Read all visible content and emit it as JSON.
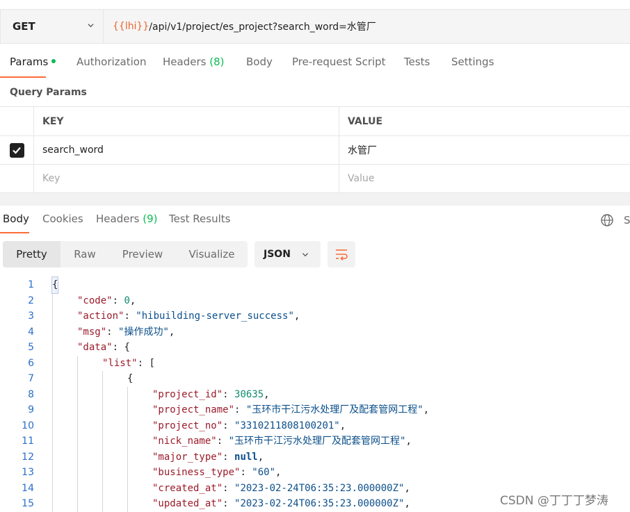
{
  "request": {
    "method": "GET",
    "url_var": "{{lhi}}",
    "url_rest": "/api/v1/project/es_project?search_word=水管厂"
  },
  "request_tabs": {
    "params": "Params",
    "authorization": "Authorization",
    "headers": "Headers",
    "headers_count": "(8)",
    "body": "Body",
    "prerequest": "Pre-request Script",
    "tests": "Tests",
    "settings": "Settings"
  },
  "query_params": {
    "title": "Query Params",
    "col_key": "KEY",
    "col_value": "VALUE",
    "row_key": "search_word",
    "row_value": "水管厂",
    "row_checked": true,
    "placeholder_key": "Key",
    "placeholder_value": "Value"
  },
  "response_tabs": {
    "body": "Body",
    "cookies": "Cookies",
    "headers": "Headers",
    "headers_count": "(9)",
    "test_results": "Test Results",
    "save_truncated": "S"
  },
  "format": {
    "pretty": "Pretty",
    "raw": "Raw",
    "preview": "Preview",
    "visualize": "Visualize",
    "language": "JSON"
  },
  "code": {
    "line_numbers": [
      "1",
      "2",
      "3",
      "4",
      "5",
      "6",
      "7",
      "8",
      "9",
      "10",
      "11",
      "12",
      "13",
      "14",
      "15"
    ],
    "l1": "{",
    "l2_key": "\"code\"",
    "l2_val": "0",
    "l3_key": "\"action\"",
    "l3_val": "\"hibuilding-server_success\"",
    "l4_key": "\"msg\"",
    "l4_val": "\"操作成功\"",
    "l5_key": "\"data\"",
    "l5_open": "{",
    "l6_key": "\"list\"",
    "l6_open": "[",
    "l7": "{",
    "l8_key": "\"project_id\"",
    "l8_val": "30635",
    "l9_key": "\"project_name\"",
    "l9_val": "\"玉环市干江污水处理厂及配套管网工程\"",
    "l10_key": "\"project_no\"",
    "l10_val": "\"3310211808100201\"",
    "l11_key": "\"nick_name\"",
    "l11_val": "\"玉环市干江污水处理厂及配套管网工程\"",
    "l12_key": "\"major_type\"",
    "l12_val": "null",
    "l13_key": "\"business_type\"",
    "l13_val": "\"60\"",
    "l14_key": "\"created_at\"",
    "l14_val": "\"2023-02-24T06:35:23.000000Z\"",
    "l15_key": "\"updated_at\"",
    "l15_val": "\"2023-02-24T06:35:23.000000Z\""
  },
  "watermark": "CSDN @丁丁丁梦涛",
  "colors": {
    "accent": "#ff6c37",
    "url_variable": "#e8682f",
    "success_dot": "#0cbb52",
    "json_key": "#9b1b2a",
    "json_string": "#0b4f8a",
    "json_number": "#118a6e"
  }
}
